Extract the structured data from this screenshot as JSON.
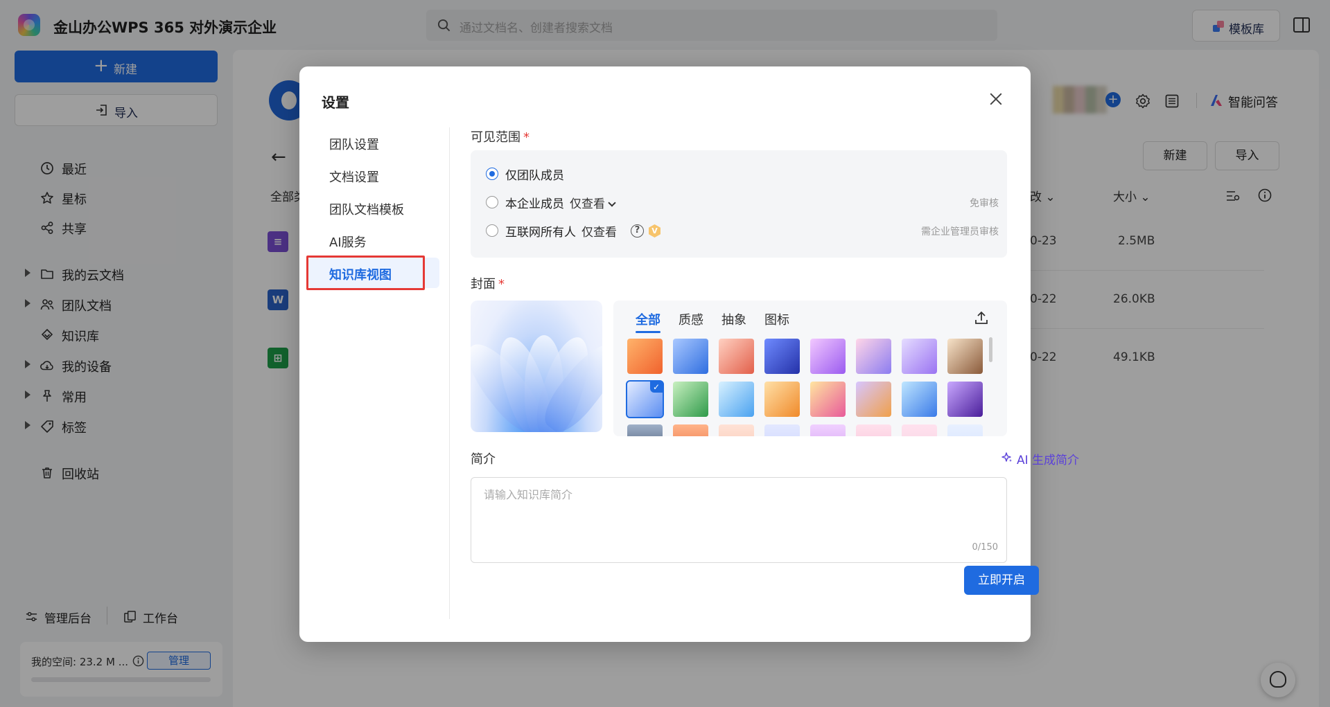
{
  "app": {
    "org_title": "金山办公WPS 365 对外演示企业"
  },
  "search": {
    "placeholder": "通过文档名、创建者搜索文档"
  },
  "topbar": {
    "template_btn": "模板库"
  },
  "sidebar": {
    "new_btn": "新建",
    "import_btn": "导入",
    "items": [
      {
        "label": "最近",
        "icon": "clock-icon",
        "expandable": false
      },
      {
        "label": "星标",
        "icon": "star-icon",
        "expandable": false
      },
      {
        "label": "共享",
        "icon": "share-icon",
        "expandable": false
      },
      {
        "label": "我的云文档",
        "icon": "folder-icon",
        "expandable": true
      },
      {
        "label": "团队文档",
        "icon": "team-icon",
        "expandable": true
      },
      {
        "label": "知识库",
        "icon": "knowledge-icon",
        "expandable": false
      },
      {
        "label": "我的设备",
        "icon": "cloud-device-icon",
        "expandable": true
      },
      {
        "label": "常用",
        "icon": "pin-icon",
        "expandable": true
      },
      {
        "label": "标签",
        "icon": "tag-icon",
        "expandable": true
      },
      {
        "label": "回收站",
        "icon": "trash-icon",
        "expandable": false
      }
    ],
    "admin_link": "管理后台",
    "workbench_link": "工作台",
    "space_label": "我的空间: 23.2 M ...",
    "manage_btn": "管理",
    "space_usage_fraction": 0.0
  },
  "main": {
    "ai_qa": "智能问答",
    "btn_new": "新建",
    "btn_import": "导入",
    "col_all": "全部类",
    "col_modified": "改",
    "col_size": "大小",
    "rows": [
      {
        "icon": "wps-note-icon",
        "icon_label": "≡",
        "color": "#7b4fd6",
        "date": "0-23",
        "size": "2.5MB"
      },
      {
        "icon": "word-doc-icon",
        "icon_label": "W",
        "color": "#2a63c9",
        "date": "0-22",
        "size": "26.0KB"
      },
      {
        "icon": "spreadsheet-icon",
        "icon_label": "⊞",
        "color": "#1e9e4a",
        "date": "0-22",
        "size": "49.1KB"
      }
    ]
  },
  "modal": {
    "title": "设置",
    "nav": [
      "团队设置",
      "文档设置",
      "团队文档模板",
      "AI服务",
      "知识库视图"
    ],
    "active_nav_index": 4,
    "visibility": {
      "label": "可见范围",
      "required_mark": "*",
      "options": [
        {
          "label": "仅团队成员",
          "perm": "",
          "hint": "",
          "checked": true
        },
        {
          "label": "本企业成员",
          "perm": "仅查看",
          "hint": "免审核",
          "checked": false
        },
        {
          "label": "互联网所有人",
          "perm": "仅查看",
          "hint": "需企业管理员审核",
          "checked": false
        }
      ]
    },
    "cover": {
      "label": "封面",
      "required_mark": "*",
      "tabs": [
        "全部",
        "质感",
        "抽象",
        "图标"
      ],
      "active_tab": 0,
      "selected_thumb": 8
    },
    "description": {
      "label": "简介",
      "ai_btn": "AI 生成简介",
      "placeholder": "请输入知识库简介",
      "value": "",
      "counter": "0/150"
    },
    "submit_btn": "立即开启"
  },
  "colors": {
    "accent": "#1f6be0",
    "ai_purple": "#5b41d9",
    "required": "#e53935",
    "highlight_box": "#e53935"
  }
}
